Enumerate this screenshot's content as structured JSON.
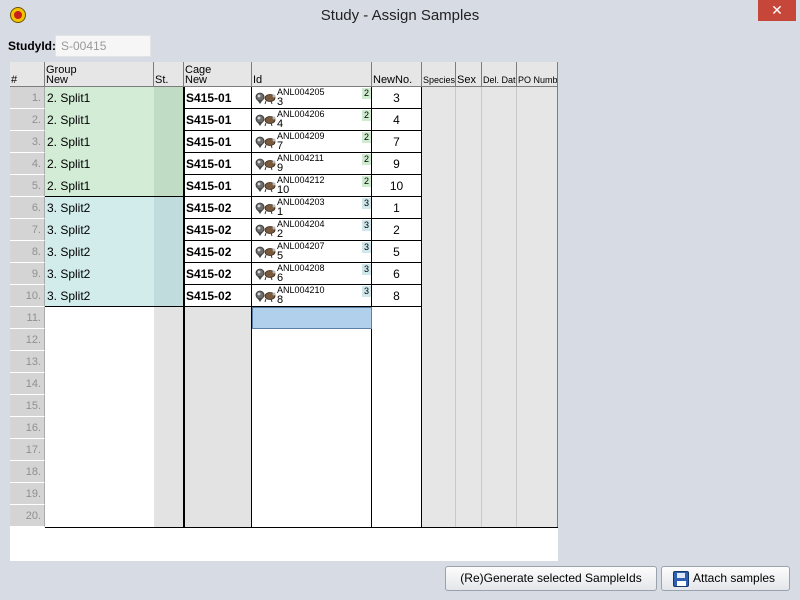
{
  "window": {
    "title": "Study - Assign Samples",
    "close_glyph": "✕"
  },
  "study": {
    "label": "StudyId:",
    "value": "S-00415"
  },
  "table": {
    "headers": {
      "rownum": "#",
      "group_top": "Group",
      "group_bottom": "New",
      "status": "St.",
      "cage_top": "Cage",
      "cage_bottom": "New",
      "id": "Id",
      "newno": "NewNo.",
      "species": "Species",
      "sex": "Sex",
      "del": "Del. Date",
      "po": "PO Number"
    },
    "rows": [
      {
        "num": "1.",
        "group": "2. Split1",
        "cage": "S415-01",
        "id_code": "ANL004205",
        "id_num": "3",
        "badge": "2",
        "newno": "3"
      },
      {
        "num": "2.",
        "group": "2. Split1",
        "cage": "S415-01",
        "id_code": "ANL004206",
        "id_num": "4",
        "badge": "2",
        "newno": "4"
      },
      {
        "num": "3.",
        "group": "2. Split1",
        "cage": "S415-01",
        "id_code": "ANL004209",
        "id_num": "7",
        "badge": "2",
        "newno": "7"
      },
      {
        "num": "4.",
        "group": "2. Split1",
        "cage": "S415-01",
        "id_code": "ANL004211",
        "id_num": "9",
        "badge": "2",
        "newno": "9"
      },
      {
        "num": "5.",
        "group": "2. Split1",
        "cage": "S415-01",
        "id_code": "ANL004212",
        "id_num": "10",
        "badge": "2",
        "newno": "10"
      },
      {
        "num": "6.",
        "group": "3. Split2",
        "cage": "S415-02",
        "id_code": "ANL004203",
        "id_num": "1",
        "badge": "3",
        "newno": "1"
      },
      {
        "num": "7.",
        "group": "3. Split2",
        "cage": "S415-02",
        "id_code": "ANL004204",
        "id_num": "2",
        "badge": "3",
        "newno": "2"
      },
      {
        "num": "8.",
        "group": "3. Split2",
        "cage": "S415-02",
        "id_code": "ANL004207",
        "id_num": "5",
        "badge": "3",
        "newno": "5"
      },
      {
        "num": "9.",
        "group": "3. Split2",
        "cage": "S415-02",
        "id_code": "ANL004208",
        "id_num": "6",
        "badge": "3",
        "newno": "6"
      },
      {
        "num": "10.",
        "group": "3. Split2",
        "cage": "S415-02",
        "id_code": "ANL004210",
        "id_num": "8",
        "badge": "3",
        "newno": "8"
      }
    ],
    "empty_rows": [
      "11.",
      "12.",
      "13.",
      "14.",
      "15.",
      "16.",
      "17.",
      "18.",
      "19.",
      "20."
    ],
    "colors": {
      "split1_bg": "#d2ecd6",
      "split1_st": "#c0dcc4",
      "split2_bg": "#d2ecec",
      "split2_st": "#c0dcdc",
      "badge_split1": "#d0ecd0",
      "badge_split2": "#d0e8ec",
      "selection": "#b1d0ec"
    },
    "icons": [
      "animal-sample-icon"
    ]
  },
  "buttons": {
    "regenerate": "(Re)Generate selected SampleIds",
    "attach": "Attach samples"
  }
}
